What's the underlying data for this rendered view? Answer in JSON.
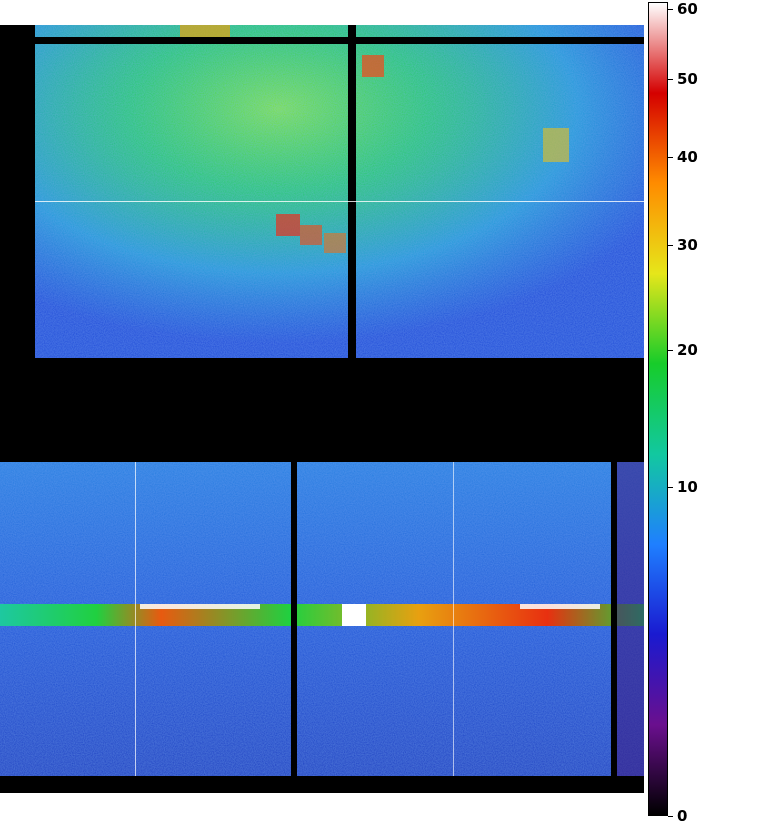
{
  "colorbar": {
    "ticks": [
      {
        "label": "60",
        "value": 60
      },
      {
        "label": "50",
        "value": 50
      },
      {
        "label": "40",
        "value": 40
      },
      {
        "label": "30",
        "value": 30
      },
      {
        "label": "20",
        "value": 20
      },
      {
        "label": "10",
        "value": 10
      },
      {
        "label": "0",
        "value": 0
      }
    ],
    "scale": "sqrt",
    "colormap": [
      "#000000",
      "#6a0f8e",
      "#1a1ad0",
      "#1f7fff",
      "#12c8a0",
      "#17cc2a",
      "#e6e61a",
      "#ff8c00",
      "#d40000",
      "#ffffff"
    ]
  },
  "panels": {
    "top": {
      "gap_color": "#000000",
      "background": "#0d3fd8"
    },
    "bottom": {
      "gap_color": "#000000",
      "background": "#1240d0",
      "streak": "#00d020"
    }
  }
}
